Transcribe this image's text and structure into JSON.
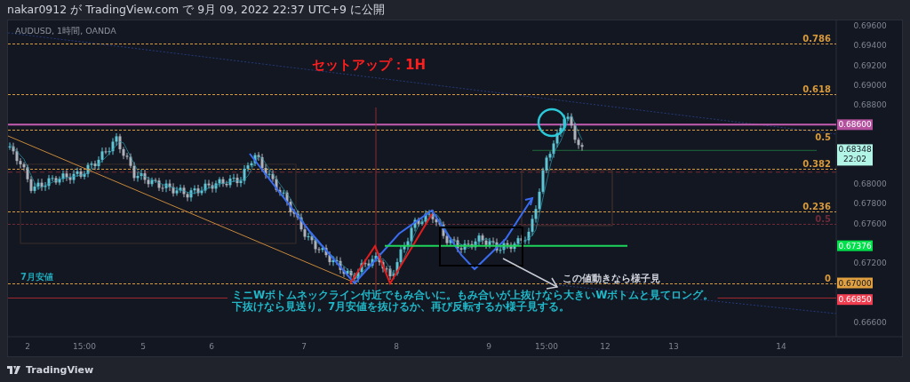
{
  "header": {
    "text": "nakar0912 が TradingView.com で 9月 09, 2022 22:37 UTC+9 に公開"
  },
  "chart": {
    "legend": "AUDUSD, 1時間, OANDA",
    "title": "セットアップ：1H",
    "low_label": "7月安値",
    "note": "この値動きなら様子見",
    "comment_lines": [
      "ミニWボトムネックライン付近でもみ合いに。もみ合いが上抜けなら大きいWボトムと見てロング。",
      "下抜けなら見送り。7月安値を抜けるか、再び反転するか様子見する。"
    ],
    "price_axis": [
      "0.69600",
      "0.69400",
      "0.69200",
      "0.69000",
      "0.68800",
      "0.68000",
      "0.67800",
      "0.67600",
      "0.67200",
      "0.66600"
    ],
    "time_axis": [
      "2",
      "15:00",
      "5",
      "6",
      "7",
      "8",
      "9",
      "15:00",
      "12",
      "13",
      "14"
    ],
    "fib_levels": [
      {
        "label": "0.786",
        "color": "#d89a3a"
      },
      {
        "label": "0.618",
        "color": "#d89a3a"
      },
      {
        "label": "0.5",
        "color": "#d89a3a"
      },
      {
        "label": "0.382",
        "color": "#d89a3a"
      },
      {
        "label": "0.236",
        "color": "#d89a3a"
      },
      {
        "label": "0.5",
        "color": "#6e2a36"
      },
      {
        "label": "0",
        "color": "#d89a3a"
      }
    ],
    "price_badges": [
      {
        "label": "0.68600",
        "color": "#b5509e"
      },
      {
        "label": "0.68348",
        "sub": "22:02",
        "color": "#b2f5e6"
      },
      {
        "label": "0.67376",
        "color": "#00e04a"
      },
      {
        "label": "0.67000",
        "color": "#e0a040"
      },
      {
        "label": "0.66850",
        "color": "#f03e50"
      }
    ]
  },
  "footer": {
    "brand": "TradingView"
  }
}
